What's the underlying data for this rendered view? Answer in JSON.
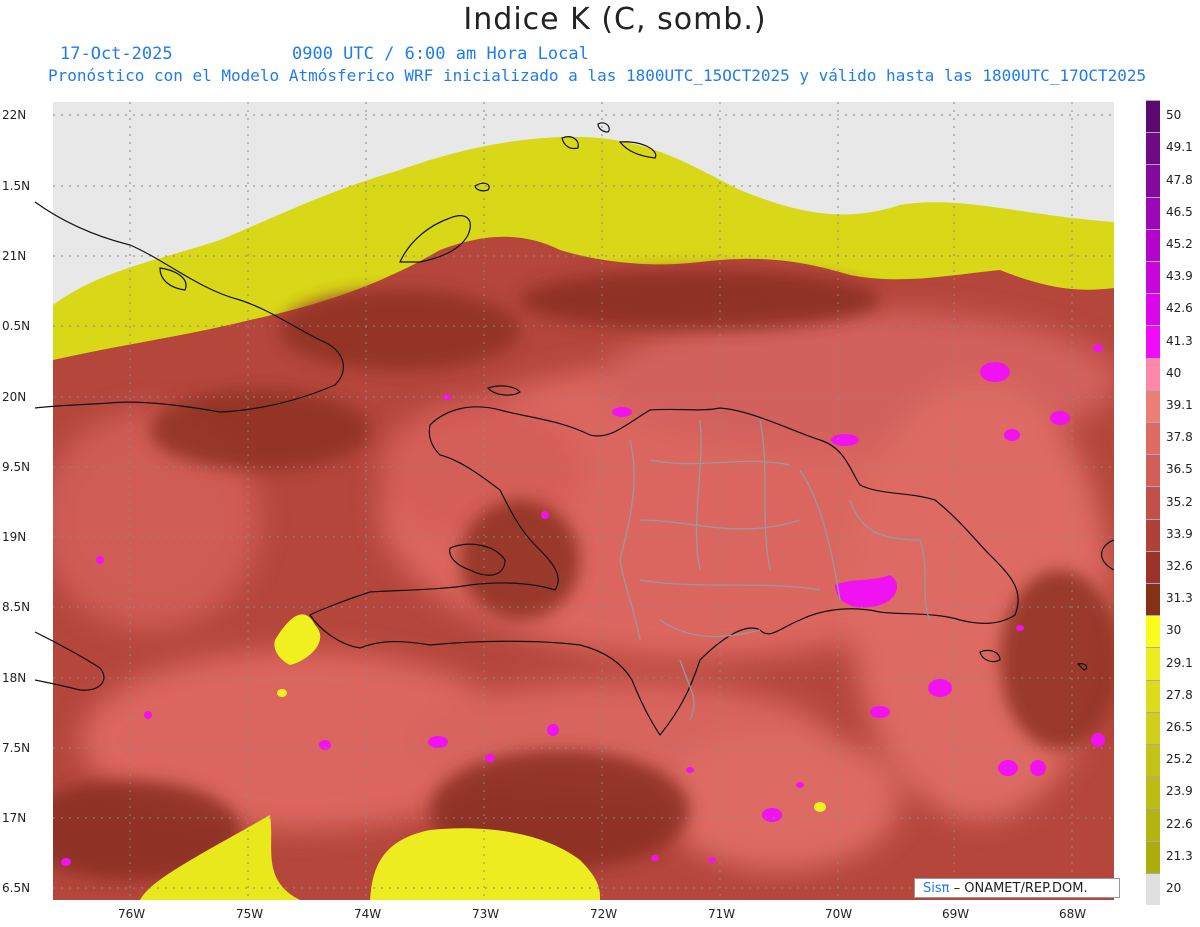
{
  "header": {
    "title": "Indice K (C, somb.)",
    "date": "17-Oct-2025",
    "time": "0900 UTC / 6:00 am Hora Local",
    "description": "Pronóstico con el Modelo Atmósferico WRF inicializado a las 1800UTC_15OCT2025 y válido hasta las  1800UTC_17OCT2025"
  },
  "axes": {
    "lat_labels": [
      "22N",
      "1.5N",
      "21N",
      "0.5N",
      "20N",
      "9.5N",
      "19N",
      "8.5N",
      "18N",
      "7.5N",
      "17N",
      "6.5N"
    ],
    "lon_labels": [
      "76W",
      "75W",
      "74W",
      "73W",
      "72W",
      "71W",
      "70W",
      "69W",
      "68W"
    ]
  },
  "colorbar": {
    "labels": [
      "50",
      "49.1",
      "47.8",
      "46.5",
      "45.2",
      "43.9",
      "42.6",
      "41.3",
      "40",
      "39.1",
      "37.8",
      "36.5",
      "35.2",
      "33.9",
      "32.6",
      "31.3",
      "30",
      "29.1",
      "27.8",
      "26.5",
      "25.2",
      "23.9",
      "22.6",
      "21.3",
      "20"
    ],
    "colors": [
      "#5a0a6e",
      "#6e0a86",
      "#86089e",
      "#9c06b6",
      "#b404cc",
      "#c806dc",
      "#dc06ec",
      "#f00cf8",
      "#ff88aa",
      "#ec7e78",
      "#e06a64",
      "#d25e58",
      "#c25048",
      "#b0403a",
      "#9c3228",
      "#86301a",
      "#fcfc1c",
      "#ecec20",
      "#dcdc1c",
      "#d0d01c",
      "#c4c418",
      "#bcbc14",
      "#b4b410",
      "#acac0c",
      "#e0e0e0"
    ]
  },
  "legend": {
    "sis": "Sisπ",
    "org": "– ONAMET/REP.DOM."
  }
}
